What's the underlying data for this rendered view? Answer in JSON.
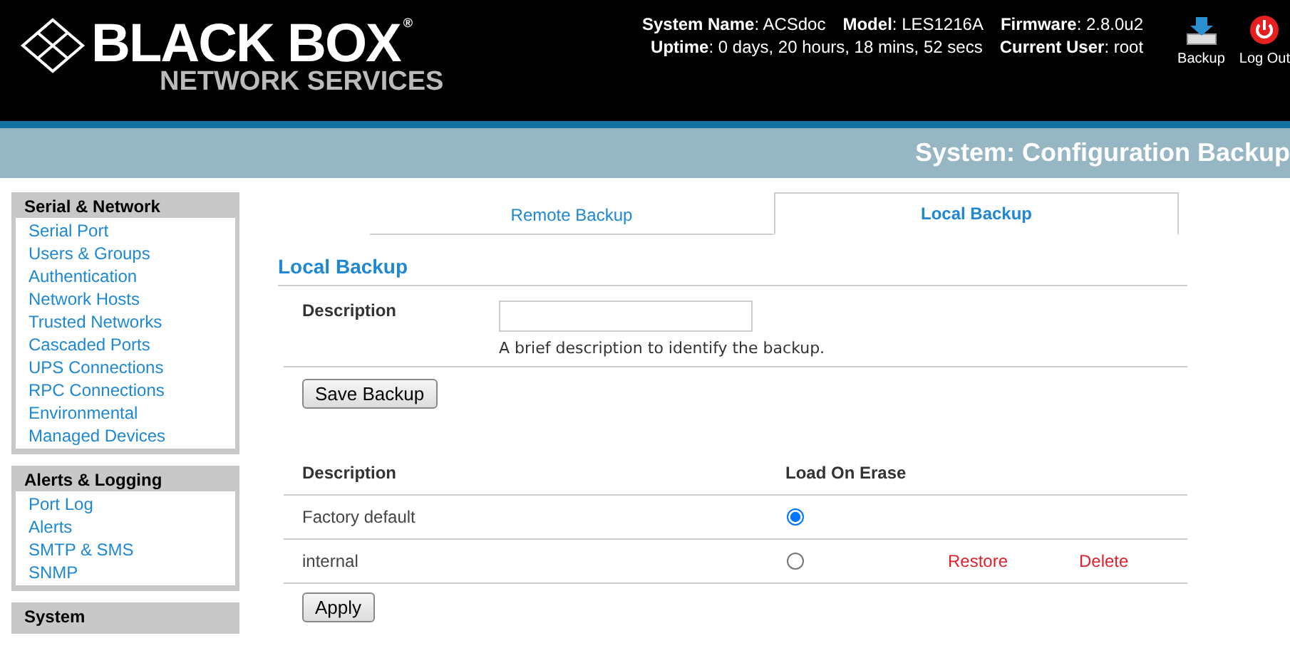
{
  "header": {
    "logo": {
      "name": "BLACK BOX",
      "mark": "®",
      "tagline": "NETWORK SERVICES"
    },
    "info": [
      [
        "**System Name**: ACSdoc",
        "**Model**: LES1216A",
        "**Firmware**: 2.8.0u2"
      ],
      [
        "**Uptime**: 0 days, 20 hours, 18 mins, 52 secs",
        "**Current User**: root"
      ]
    ],
    "actions": [
      {
        "kind": "backup",
        "label": "Backup"
      },
      {
        "kind": "logout",
        "label": "Log Out"
      }
    ]
  },
  "page_title": "System: Configuration Backup",
  "sidebar": [
    {
      "title": "Serial & Network",
      "items": [
        "Serial Port",
        "Users & Groups",
        "Authentication",
        "Network Hosts",
        "Trusted Networks",
        "Cascaded Ports",
        "UPS Connections",
        "RPC Connections",
        "Environmental",
        "Managed Devices"
      ]
    },
    {
      "title": "Alerts & Logging",
      "items": [
        "Port Log",
        "Alerts",
        "SMTP & SMS",
        "SNMP"
      ]
    },
    {
      "title": "System"
    }
  ],
  "tabs": [
    {
      "label": "Remote Backup",
      "selected": false
    },
    {
      "label": "Local Backup",
      "selected": true
    }
  ],
  "section_title": "Local Backup",
  "form": {
    "label": "Description",
    "help": "A brief description to identify the backup.",
    "button": "Save Backup"
  },
  "table": {
    "columns": [
      "Description",
      "Load On Erase"
    ],
    "rows": [
      {
        "name": "Factory default",
        "selected": true
      },
      {
        "name": "internal",
        "selected": false,
        "actions": [
          "Restore",
          "Delete"
        ]
      }
    ]
  },
  "apply": "Apply"
}
